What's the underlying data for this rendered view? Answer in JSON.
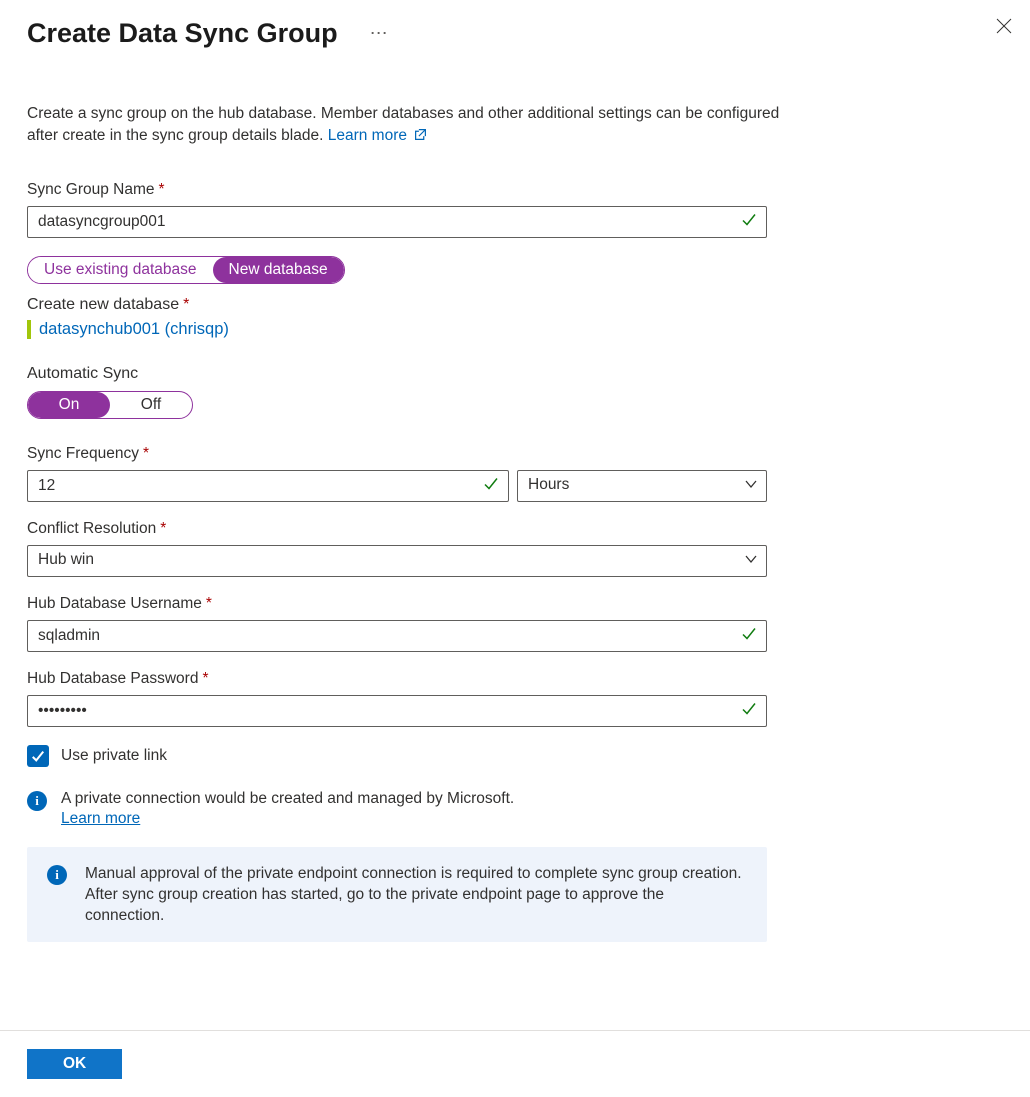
{
  "header": {
    "title": "Create Data Sync Group",
    "more": "⋯"
  },
  "intro": {
    "text": "Create a sync group on the hub database. Member databases and other additional settings can be configured after create in the sync group details blade.",
    "link": "Learn more"
  },
  "fields": {
    "syncGroupName": {
      "label": "Sync Group Name",
      "value": "datasyncgroup001"
    },
    "dbToggle": {
      "existing": "Use existing database",
      "newdb": "New database"
    },
    "createDb": {
      "label": "Create new database",
      "link": "datasynchub001 (chrisqp)"
    },
    "autoSync": {
      "label": "Automatic Sync",
      "on": "On",
      "off": "Off"
    },
    "syncFreq": {
      "label": "Sync Frequency",
      "value": "12",
      "unit": "Hours"
    },
    "conflict": {
      "label": "Conflict Resolution",
      "value": "Hub win"
    },
    "hubUser": {
      "label": "Hub Database Username",
      "value": "sqladmin"
    },
    "hubPass": {
      "label": "Hub Database Password",
      "value": "•••••••••"
    },
    "privateLink": {
      "label": "Use private link"
    }
  },
  "info1": {
    "text": "A private connection would be created and managed by Microsoft.",
    "link": "Learn more"
  },
  "info2": {
    "text": "Manual approval of the private endpoint connection is required to complete sync group creation. After sync group creation has started, go to the private endpoint page to approve the connection."
  },
  "footer": {
    "ok": "OK"
  }
}
